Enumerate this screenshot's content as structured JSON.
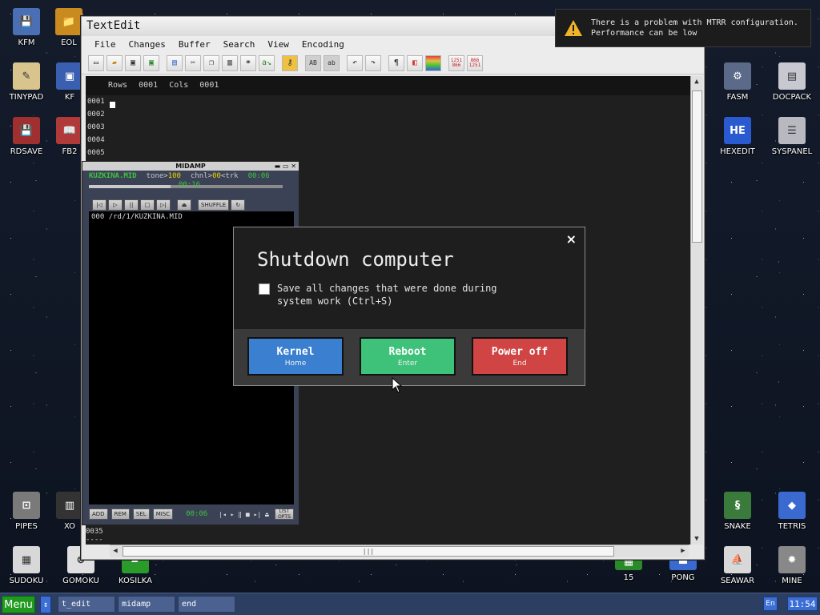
{
  "desktop": {
    "icons_left": [
      {
        "label": "KFM",
        "glyph": "💾",
        "color": "#4a6fb5"
      },
      {
        "label": "EOL",
        "glyph": "📁",
        "color": "#c98a20"
      },
      {
        "label": "TINYPAD",
        "glyph": "✎",
        "color": "#d8c48c"
      },
      {
        "label": "KF",
        "glyph": "▣",
        "color": "#3b5fb0"
      },
      {
        "label": "RDSAVE",
        "glyph": "💾",
        "color": "#a03030"
      },
      {
        "label": "FB2",
        "glyph": "📖",
        "color": "#b03a3a"
      },
      {
        "label": "PIPES",
        "glyph": "⊡",
        "color": "#7a7a7a"
      },
      {
        "label": "XO",
        "glyph": "▥",
        "color": "#333333"
      },
      {
        "label": "SUDOKU",
        "glyph": "▦",
        "color": "#d8d8d8"
      },
      {
        "label": "GOMOKU",
        "glyph": "⊗",
        "color": "#e0e0e0"
      },
      {
        "label": "KOSILKA",
        "glyph": "▰",
        "color": "#2a9a2a"
      }
    ],
    "icons_right": [
      {
        "label": "FASM",
        "glyph": "⚙",
        "color": "#5a6a88"
      },
      {
        "label": "DOCPACK",
        "glyph": "▤",
        "color": "#c8c8d0"
      },
      {
        "label": "HEXEDIT",
        "glyph": "HE",
        "color": "#2a5ad0"
      },
      {
        "label": "SYSPANEL",
        "glyph": "☰",
        "color": "#b8b8c0"
      },
      {
        "label": "SNAKE",
        "glyph": "§",
        "color": "#3a7a3a"
      },
      {
        "label": "TETRIS",
        "glyph": "◆",
        "color": "#3a6ad0"
      },
      {
        "label": "15",
        "glyph": "▦",
        "color": "#2a8a2a"
      },
      {
        "label": "PONG",
        "glyph": "▬",
        "color": "#3a6ad0"
      },
      {
        "label": "SEAWAR",
        "glyph": "⛵",
        "color": "#d8d8d8"
      },
      {
        "label": "MINE",
        "glyph": "✹",
        "color": "#888888"
      }
    ]
  },
  "notification": {
    "icon": "warning-icon",
    "line1": "There is a problem with MTRR configuration.",
    "line2": "Performance can be low"
  },
  "textedit": {
    "title": "TextEdit",
    "menu": [
      "File",
      "Changes",
      "Buffer",
      "Search",
      "View",
      "Encoding"
    ],
    "toolbar": [
      "new-icon",
      "open-icon",
      "save-icon",
      "save-as-icon",
      "select-icon",
      "cut-icon",
      "copy-icon",
      "paste-icon",
      "find-icon",
      "replace-icon",
      "key-icon",
      "uppercase-icon",
      "lowercase-icon",
      "undo-icon",
      "redo-icon",
      "pilcrow-icon",
      "color-icon",
      "syntax-icon",
      "cp1251-866-icon",
      "cp866-1251-icon"
    ],
    "toolbar_labels": {
      "uppercase": "AB",
      "lowercase": "ab",
      "pilcrow": "¶",
      "cp1": "1251\n866",
      "cp2": "866\n1251"
    },
    "status": {
      "rows_label": "Rows",
      "rows_value": "0001",
      "cols_label": "Cols",
      "cols_value": "0001"
    },
    "line_numbers": [
      "0001",
      "0002",
      "0003",
      "0004",
      "0005"
    ],
    "bottom_lines": [
      "0035",
      "----"
    ],
    "hscroll_grip": "|||"
  },
  "midamp": {
    "title": "MIDAMP",
    "song": "KUZKINA.MID",
    "tone_label": "tone>",
    "tone_value": "100",
    "chnl_label": "chnl>",
    "chnl_value": "00",
    "trk_label": "<trk",
    "time_total": "00:06",
    "time_progress": "00:16",
    "progress": 0.42,
    "controls": [
      "|◁",
      "▷",
      "||",
      "□",
      "▷|"
    ],
    "eject": "⏏",
    "shuffle": "SHUFFLE",
    "repeat": "↻",
    "playlist": [
      {
        "num": "000",
        "path": "/rd/1/KUZKINA.MID"
      }
    ],
    "bottom_buttons": [
      "ADD",
      "REM",
      "SEL",
      "MISC"
    ],
    "bottom_time": "00:06",
    "list_opts": "LIST OPTS"
  },
  "shutdown": {
    "title": "Shutdown computer",
    "checkbox_text": "Save all changes that were done during system work (Ctrl+S)",
    "checked": false,
    "buttons": [
      {
        "label": "Kernel",
        "sub": "Home",
        "color": "#3b7fd1"
      },
      {
        "label": "Reboot",
        "sub": "Enter",
        "color": "#3ec27a"
      },
      {
        "label": "Power off",
        "sub": "End",
        "color": "#d14444"
      }
    ],
    "close": "×"
  },
  "taskbar": {
    "menu": "Menu",
    "switch": "↕",
    "tasks": [
      "t_edit",
      "midamp",
      "end"
    ],
    "lang": "En",
    "clock": "11:54"
  }
}
